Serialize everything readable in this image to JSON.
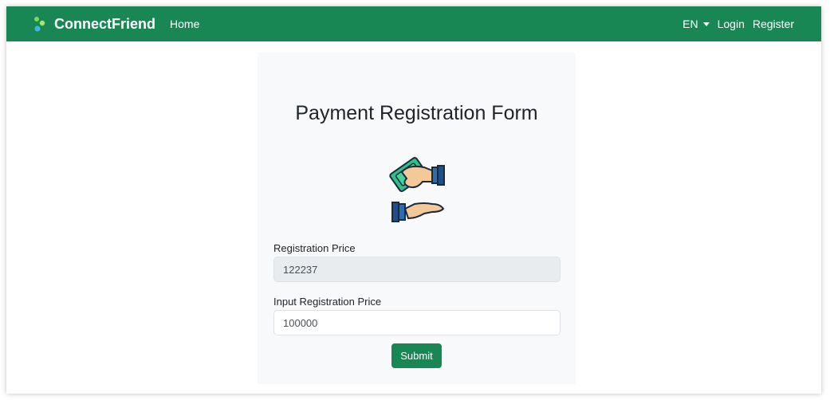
{
  "navbar": {
    "brand": "ConnectFriend",
    "home": "Home",
    "language": "EN",
    "login": "Login",
    "register": "Register",
    "icons": {
      "brand": "droplets-logo-icon",
      "language": "caret-down-icon"
    }
  },
  "form": {
    "title": "Payment Registration Form",
    "illustration_icon": "hands-exchanging-money-icon",
    "registration_price_label": "Registration Price",
    "registration_price_value": "122237",
    "input_price_label": "Input Registration Price",
    "input_price_value": "100000",
    "submit_label": "Submit"
  },
  "colors": {
    "primary": "#198754",
    "card_background": "#f8f9fa",
    "readonly_background": "#e9ecef"
  }
}
